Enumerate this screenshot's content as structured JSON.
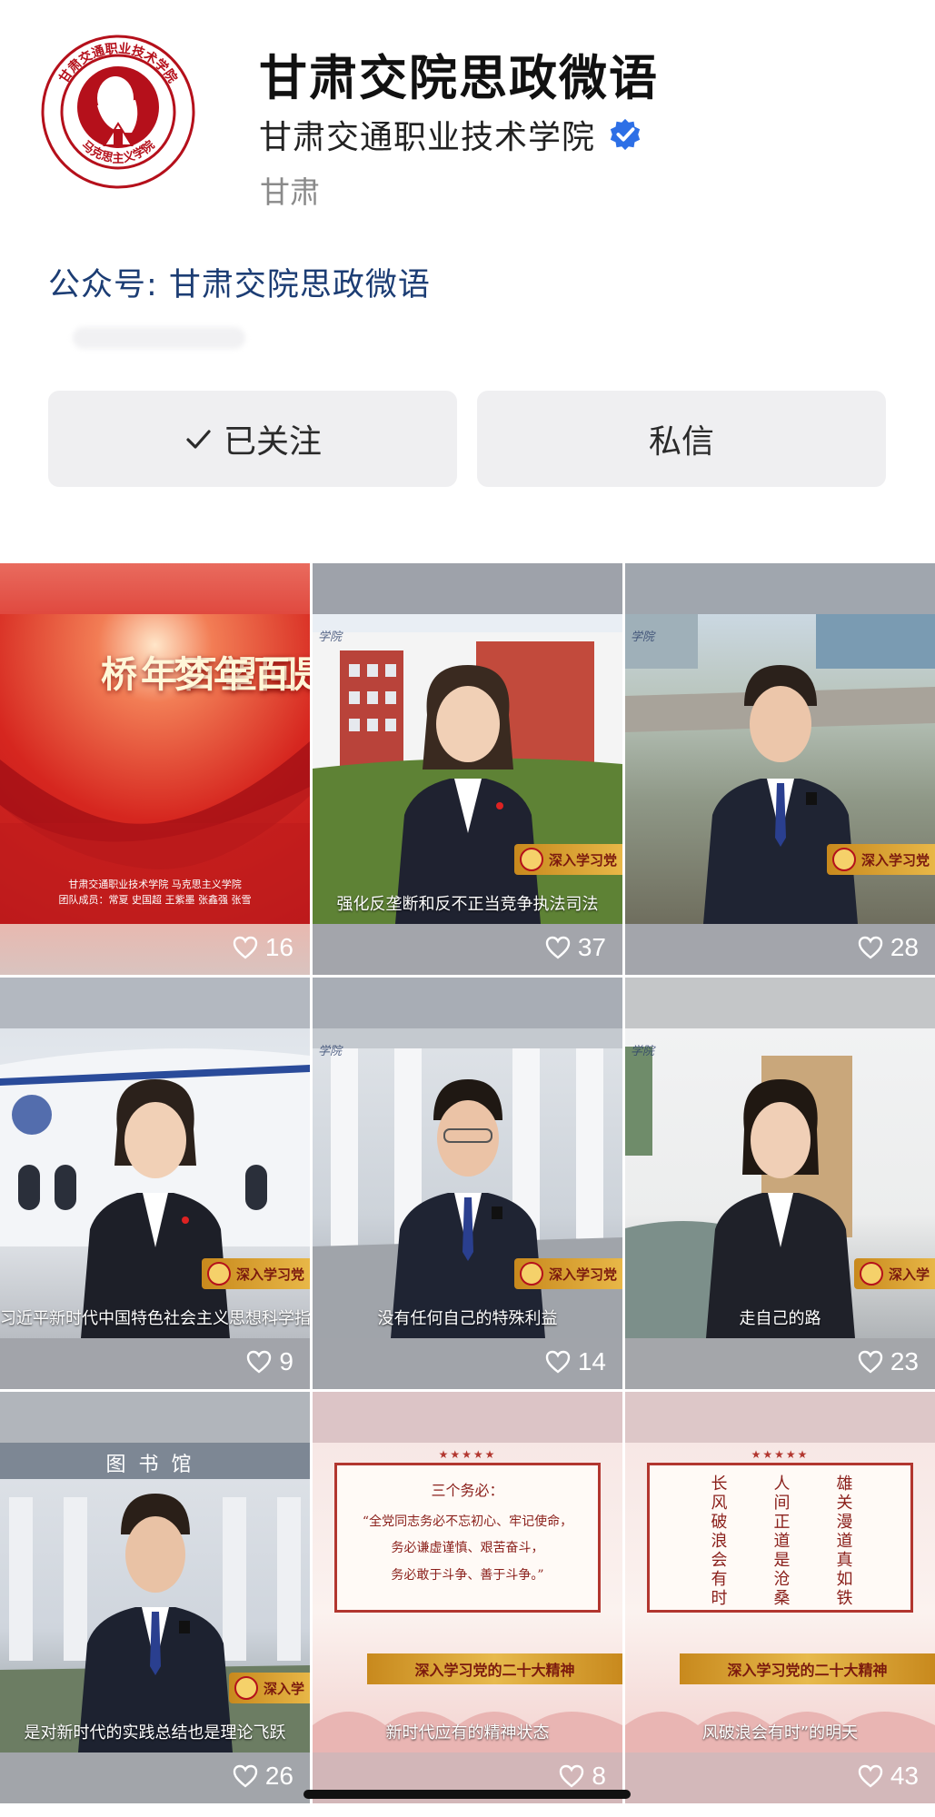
{
  "profile": {
    "name": "甘肃交院思政微语",
    "organization": "甘肃交通职业技术学院",
    "location": "甘肃",
    "account_label": "公众号: 甘肃交院思政微语",
    "avatar_text_top": "甘肃交通职业技术学院",
    "avatar_text_bottom": "马克思主义学院"
  },
  "actions": {
    "follow_label": "已关注",
    "message_label": "私信"
  },
  "icons": {
    "verified": "verified-badge-icon",
    "check": "check-icon",
    "like": "heart-icon"
  },
  "colors": {
    "account_blue": "#1c3d74",
    "verified_blue": "#2d6fe6",
    "party_red": "#b5101b",
    "badge_gold": "#e3b043"
  },
  "videos": [
    {
      "likes": "16",
      "poster_title_left": "回望百年桥",
      "poster_title_right": "恰是百年梦",
      "poster_line1": "甘肃交通职业技术学院 马克思主义学院",
      "poster_line2": "团队成员：常夏 史国超 王紫墨 张鑫强 张雪"
    },
    {
      "likes": "37",
      "caption": "强化反垄断和反不正当竞争执法司法",
      "badge": "深入学习党"
    },
    {
      "likes": "28",
      "badge": "深入学习党"
    },
    {
      "likes": "9",
      "caption": "习近平新时代中国特色社会主义思想科学指引",
      "badge": "深入学习党"
    },
    {
      "likes": "14",
      "caption": "没有任何自己的特殊利益",
      "badge": "深入学习党"
    },
    {
      "likes": "23",
      "caption": "走自己的路",
      "badge": "深入学"
    },
    {
      "likes": "26",
      "caption": "是对新时代的实践总结也是理论飞跃",
      "badge": "深入学",
      "building_sign": "图书馆"
    },
    {
      "likes": "8",
      "caption": "新时代应有的精神状态",
      "banner": "深入学习党的二十大精神",
      "stars": "★★★★★",
      "quote_head": "三个务必：",
      "quote_lines": [
        "“全党同志务必不忘初心、牢记使命，",
        "务必谦虚谨慎、艰苦奋斗，",
        "务必敢于斗争、善于斗争。”"
      ]
    },
    {
      "likes": "43",
      "caption": "风破浪会有时”的明天",
      "banner": "深入学习党的二十大精神",
      "stars": "★★★★★",
      "poem_cols": [
        "长风破浪会有时",
        "人间正道是沧桑",
        "雄关漫道真如铁"
      ]
    }
  ]
}
